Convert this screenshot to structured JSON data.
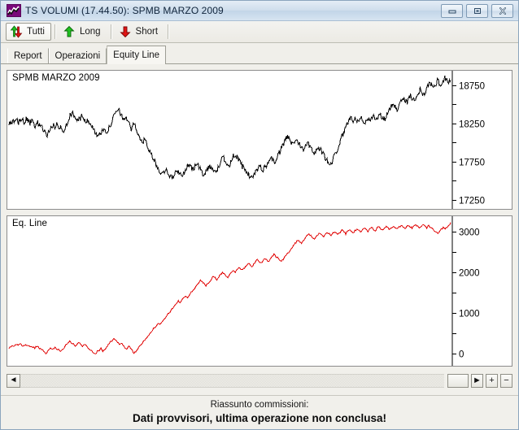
{
  "window": {
    "title": "TS VOLUMI (17.44.50): SPMB MARZO 2009",
    "icon": "chart-line-icon",
    "buttons": {
      "minimize": "minimize-icon",
      "restore": "restore-icon",
      "close": "close-icon"
    }
  },
  "toolbar": {
    "items": [
      {
        "label": "Tutti",
        "icon": "up-down-arrow-icon",
        "active": true
      },
      {
        "label": "Long",
        "icon": "green-up-arrow-icon",
        "active": false
      },
      {
        "label": "Short",
        "icon": "red-down-arrow-icon",
        "active": false
      }
    ]
  },
  "tabs": [
    {
      "label": "Report",
      "active": false
    },
    {
      "label": "Operazioni",
      "active": false
    },
    {
      "label": "Equity Line",
      "active": true
    }
  ],
  "scrollbar": {
    "left_arrow": "◄",
    "right_arrow": "►",
    "zoom_in": "+",
    "zoom_out": "−",
    "blank_label": ""
  },
  "footer": {
    "line1": "Riassunto commissioni:",
    "line2": "Dati provvisori, ultima operazione non conclusa!"
  },
  "colors": {
    "price_line": "#000000",
    "equity_line": "#e00000",
    "chart_bg": "#ffffff",
    "panel_bg": "#f1f0eb",
    "title_accent": "#7a0a7a"
  },
  "chart_data": [
    {
      "type": "line",
      "title": "SPMB MARZO 2009",
      "xlabel": "",
      "ylabel": "",
      "ylim": [
        17150,
        18900
      ],
      "yticks": [
        17250,
        17750,
        18250,
        18750
      ],
      "ytick_labels": [
        "17250",
        "17750",
        "18250",
        "18750"
      ],
      "minor_ticks": [
        17500,
        18000,
        18500
      ],
      "grid": false,
      "legend": "none",
      "series": [
        {
          "name": "SPMB MARZO 2009",
          "color": "#000000",
          "values": [
            18230,
            18255,
            18270,
            18250,
            18295,
            18275,
            18310,
            18290,
            18265,
            18300,
            18280,
            18250,
            18270,
            18245,
            18215,
            18260,
            18240,
            18205,
            18170,
            18130,
            18100,
            18145,
            18190,
            18230,
            18200,
            18245,
            18170,
            18215,
            18130,
            18185,
            18240,
            18300,
            18350,
            18395,
            18360,
            18320,
            18280,
            18310,
            18345,
            18300,
            18265,
            18300,
            18270,
            18230,
            18180,
            18145,
            18110,
            18075,
            18120,
            18160,
            18200,
            18140,
            18175,
            18230,
            18290,
            18345,
            18395,
            18430,
            18400,
            18350,
            18300,
            18340,
            18290,
            18230,
            18180,
            18270,
            18210,
            18150,
            18090,
            18030,
            17975,
            18050,
            17990,
            17930,
            17870,
            17810,
            17760,
            17700,
            17660,
            17620,
            17580,
            17620,
            17660,
            17610,
            17570,
            17530,
            17560,
            17600,
            17640,
            17600,
            17560,
            17590,
            17630,
            17670,
            17710,
            17680,
            17640,
            17680,
            17720,
            17690,
            17650,
            17610,
            17580,
            17620,
            17660,
            17700,
            17670,
            17630,
            17600,
            17650,
            17700,
            17760,
            17810,
            17770,
            17730,
            17690,
            17740,
            17800,
            17850,
            17810,
            17770,
            17730,
            17690,
            17660,
            17620,
            17590,
            17560,
            17530,
            17570,
            17610,
            17650,
            17700,
            17670,
            17640,
            17680,
            17720,
            17760,
            17800,
            17770,
            17740,
            17790,
            17840,
            17890,
            17940,
            18010,
            18080,
            18060,
            18020,
            17980,
            18010,
            18040,
            18010,
            17980,
            17950,
            17920,
            17960,
            18000,
            17970,
            17940,
            17900,
            17860,
            17900,
            17940,
            17900,
            17860,
            17820,
            17780,
            17740,
            17700,
            17750,
            17810,
            17870,
            17930,
            18000,
            18070,
            18130,
            18180,
            18240,
            18310,
            18370,
            18280,
            18330,
            18270,
            18310,
            18350,
            18290,
            18240,
            18280,
            18320,
            18270,
            18310,
            18350,
            18300,
            18340,
            18390,
            18340,
            18290,
            18330,
            18370,
            18420,
            18470,
            18520,
            18480,
            18440,
            18490,
            18540,
            18600,
            18560,
            18520,
            18570,
            18620,
            18580,
            18540,
            18590,
            18640,
            18700,
            18660,
            18620,
            18680,
            18740,
            18790,
            18750,
            18700,
            18760,
            18820,
            18780,
            18740,
            18800,
            18860,
            18820,
            18780,
            18830
          ]
        }
      ]
    },
    {
      "type": "line",
      "title": "Eq. Line",
      "xlabel": "",
      "ylabel": "",
      "ylim": [
        -260,
        3300
      ],
      "yticks": [
        0,
        1000,
        2000,
        3000
      ],
      "ytick_labels": [
        "0",
        "1000",
        "2000",
        "3000"
      ],
      "minor_ticks": [
        500,
        1500,
        2500
      ],
      "grid": false,
      "legend": "none",
      "series": [
        {
          "name": "Eq. Line",
          "color": "#e00000",
          "values": [
            120,
            160,
            200,
            175,
            215,
            195,
            235,
            210,
            185,
            225,
            200,
            170,
            190,
            160,
            130,
            175,
            150,
            115,
            80,
            40,
            10,
            55,
            100,
            140,
            110,
            155,
            80,
            125,
            40,
            95,
            150,
            210,
            260,
            300,
            270,
            230,
            190,
            230,
            265,
            220,
            185,
            225,
            190,
            150,
            105,
            70,
            35,
            0,
            45,
            85,
            125,
            65,
            100,
            155,
            215,
            270,
            320,
            355,
            325,
            275,
            225,
            265,
            215,
            155,
            105,
            195,
            135,
            75,
            15,
            60,
            110,
            170,
            230,
            290,
            350,
            410,
            470,
            530,
            580,
            630,
            690,
            750,
            700,
            760,
            820,
            880,
            940,
            1000,
            1060,
            1120,
            1180,
            1240,
            1300,
            1250,
            1310,
            1370,
            1430,
            1380,
            1440,
            1500,
            1560,
            1620,
            1680,
            1740,
            1800,
            1760,
            1720,
            1660,
            1720,
            1780,
            1840,
            1900,
            1860,
            1820,
            1880,
            1940,
            2000,
            1960,
            1920,
            1880,
            1940,
            2000,
            2060,
            2010,
            2070,
            2130,
            2090,
            2050,
            2110,
            2170,
            2220,
            2180,
            2140,
            2200,
            2260,
            2310,
            2270,
            2230,
            2290,
            2350,
            2300,
            2260,
            2320,
            2380,
            2440,
            2400,
            2360,
            2310,
            2260,
            2320,
            2380,
            2440,
            2500,
            2560,
            2620,
            2680,
            2740,
            2800,
            2760,
            2720,
            2780,
            2840,
            2900,
            2950,
            2900,
            2860,
            2820,
            2870,
            2920,
            2970,
            2930,
            2890,
            2940,
            2990,
            2950,
            2910,
            2960,
            3010,
            2970,
            2930,
            2980,
            3030,
            2990,
            2950,
            3000,
            3050,
            3010,
            2970,
            3020,
            3070,
            3030,
            2990,
            3040,
            3090,
            3050,
            3010,
            3060,
            3110,
            3070,
            3030,
            3080,
            3120,
            3080,
            3040,
            3090,
            3130,
            3090,
            3050,
            3100,
            3140,
            3100,
            3060,
            3110,
            3150,
            3110,
            3070,
            3120,
            3160,
            3120,
            3080,
            3130,
            3170,
            3130,
            3090,
            3140,
            3180,
            3140,
            3100,
            3150,
            3120,
            3080,
            3040,
            3000,
            2960,
            3010,
            3060,
            3110,
            3070,
            3120,
            3170,
            3210
          ]
        }
      ]
    }
  ]
}
